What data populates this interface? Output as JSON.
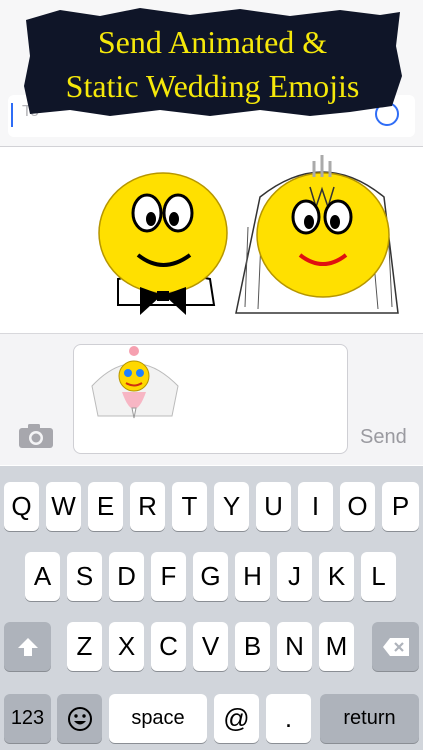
{
  "banner": {
    "line1": "Send Animated &",
    "line2": "Static Wedding Emojis"
  },
  "search": {
    "hint": "To"
  },
  "compose": {
    "send_label": "Send"
  },
  "keyboard": {
    "row1": [
      "Q",
      "W",
      "E",
      "R",
      "T",
      "Y",
      "U",
      "I",
      "O",
      "P"
    ],
    "row2": [
      "A",
      "S",
      "D",
      "F",
      "G",
      "H",
      "J",
      "K",
      "L"
    ],
    "row3": [
      "Z",
      "X",
      "C",
      "V",
      "B",
      "N",
      "M"
    ],
    "numbers_label": "123",
    "space_label": "space",
    "at_label": "@",
    "period_label": ".",
    "return_label": "return"
  },
  "colors": {
    "accent": "#2f6df6",
    "banner_text": "#f5e80a",
    "emoji_yellow": "#ffe000"
  },
  "icons": [
    "camera-icon",
    "shift-icon",
    "delete-icon",
    "emoji-icon",
    "add-contact-icon"
  ]
}
